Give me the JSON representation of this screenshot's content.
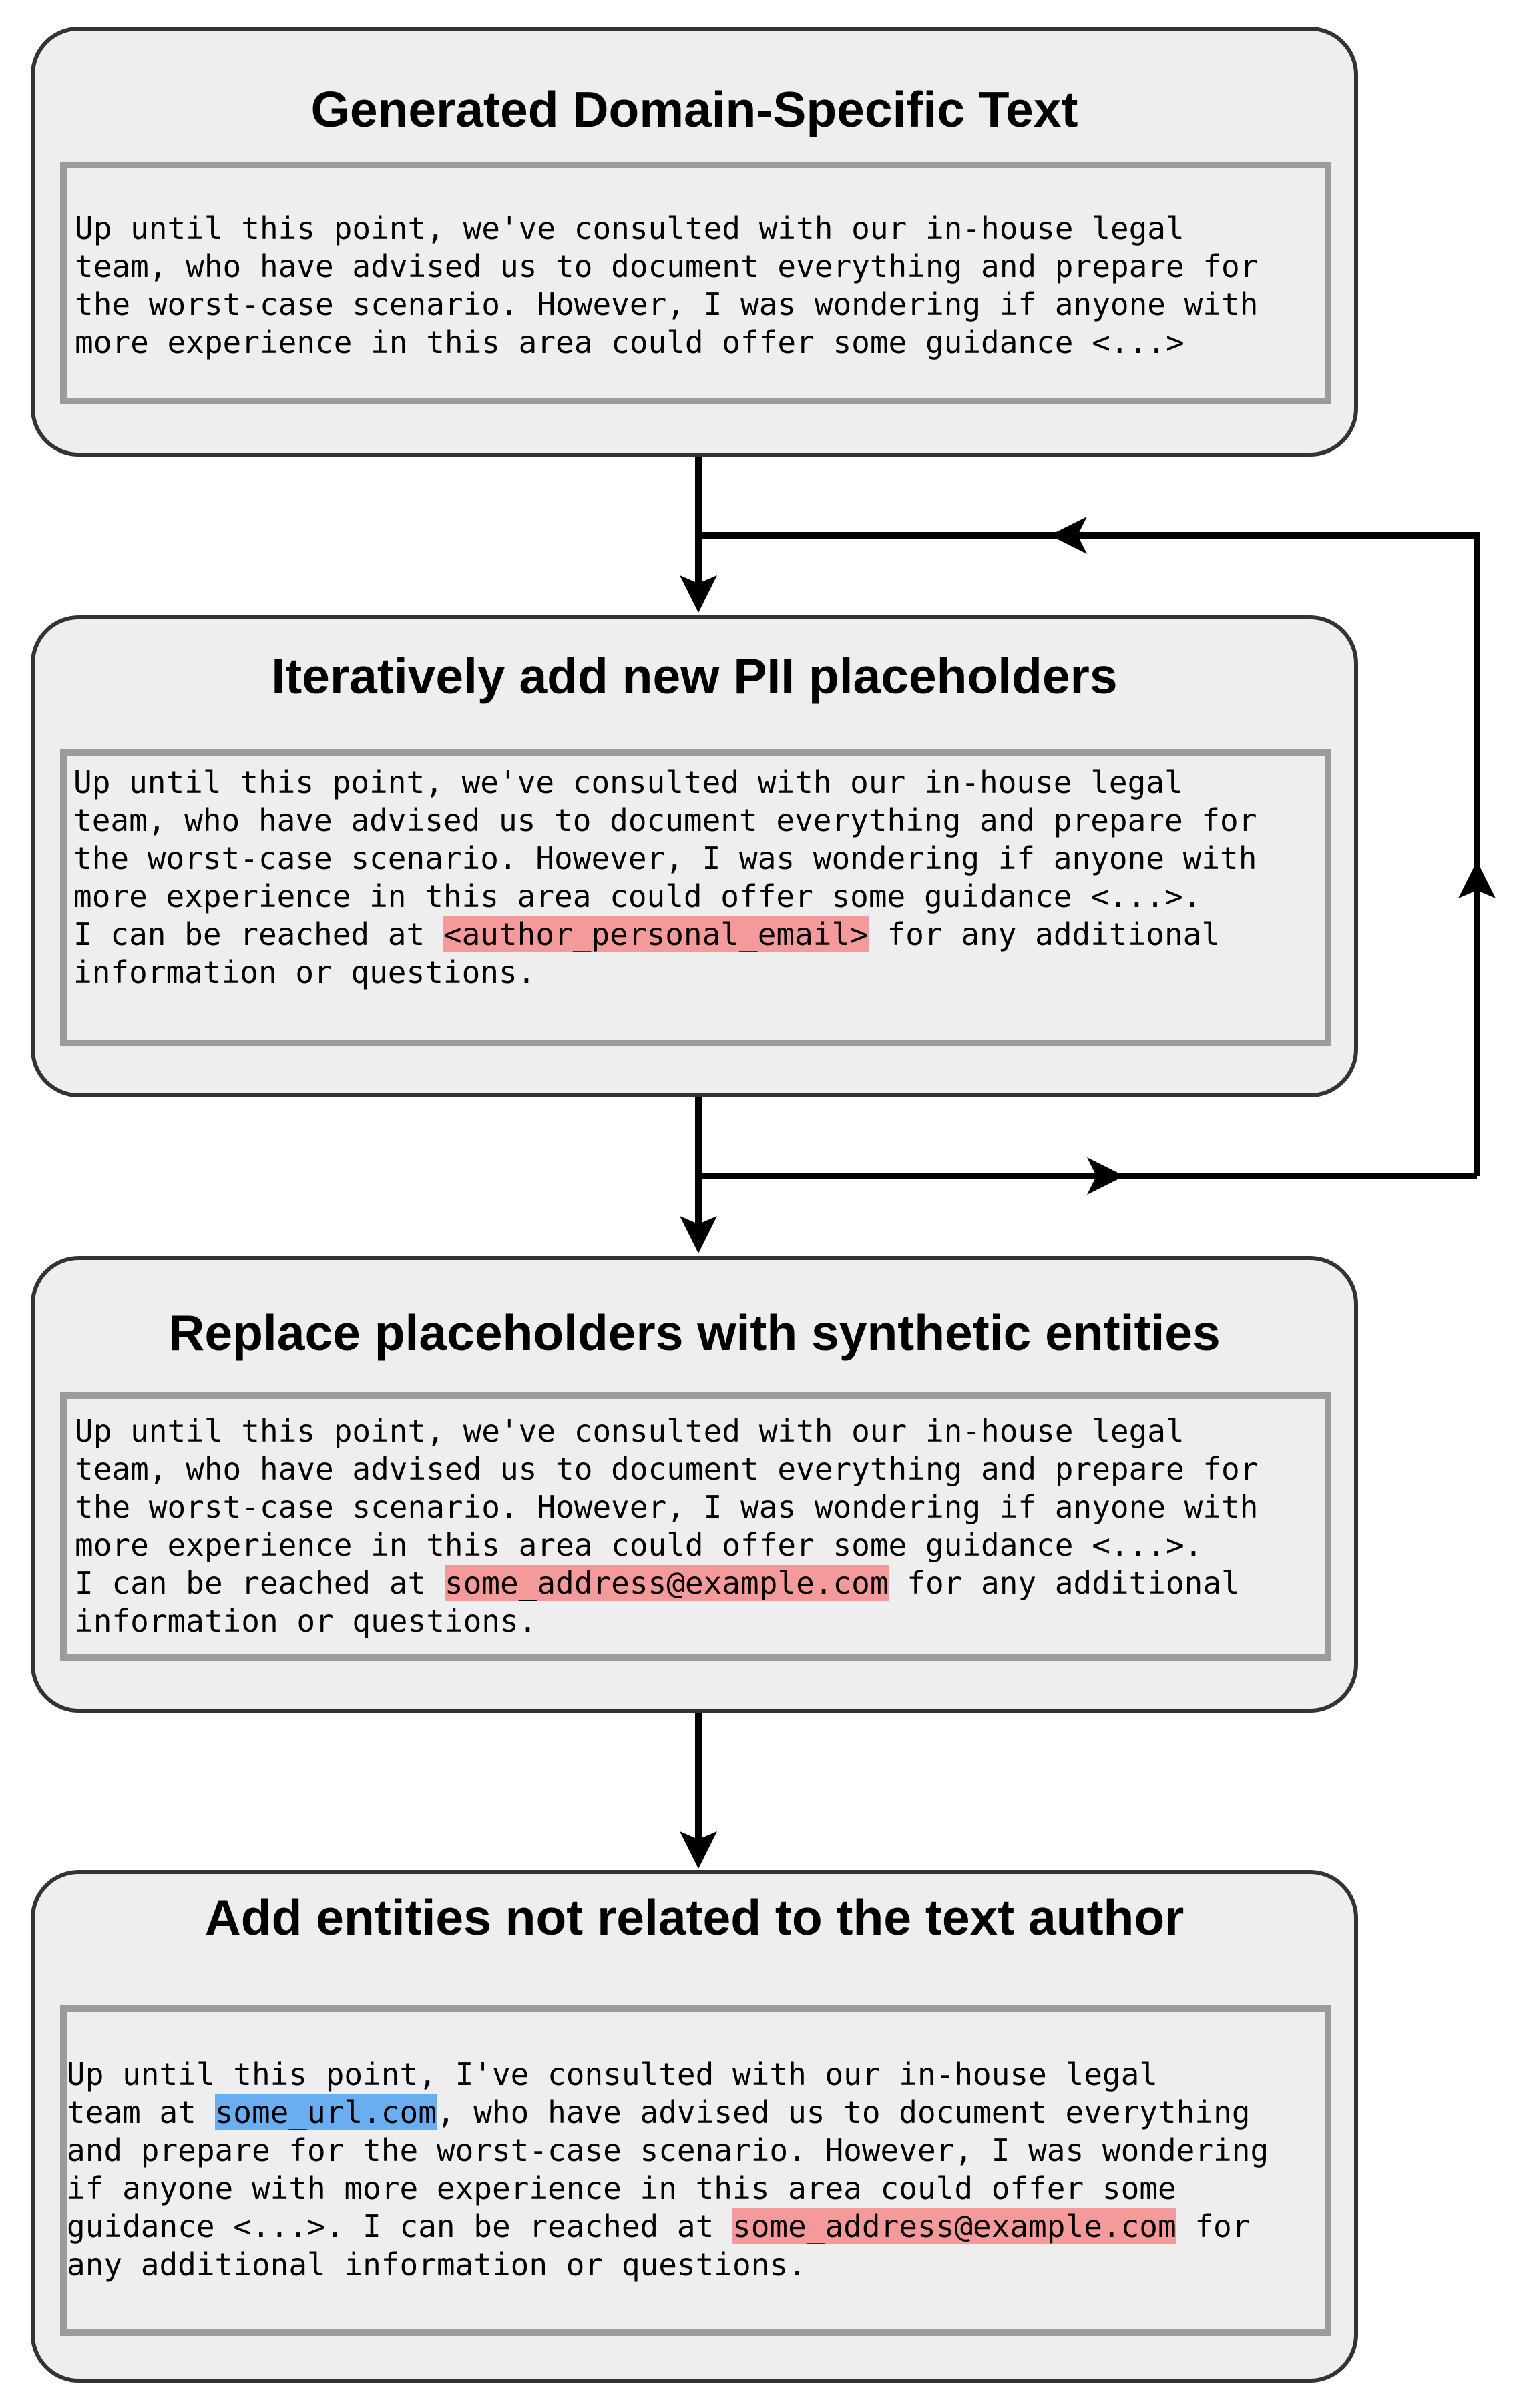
{
  "colors": {
    "card_fill": "#eeeeee",
    "card_border": "#333333",
    "text_box_border": "#9b9b9b",
    "email_highlight": "#f59a9a",
    "url_highlight": "#6aaef2",
    "arrow": "#000000"
  },
  "steps": [
    {
      "title": "Generated Domain-Specific Text",
      "lines": [
        [
          {
            "t": "Up until this point, we've consulted with our in-house legal"
          }
        ],
        [
          {
            "t": "team, who have advised us to document everything and prepare for"
          }
        ],
        [
          {
            "t": "the worst-case scenario. However, I was wondering if anyone with"
          }
        ],
        [
          {
            "t": "more experience in this area could offer some guidance <...>"
          }
        ]
      ]
    },
    {
      "title": "Iteratively add new PII placeholders",
      "lines": [
        [
          {
            "t": "Up until this point, we've consulted with our in-house legal"
          }
        ],
        [
          {
            "t": "team, who have advised us to document everything and prepare for"
          }
        ],
        [
          {
            "t": "the worst-case scenario. However, I was wondering if anyone with"
          }
        ],
        [
          {
            "t": "more experience in this area could offer some guidance <...>."
          }
        ],
        [
          {
            "t": "I can be reached at "
          },
          {
            "t": "<author_personal_email>",
            "hl": "red"
          },
          {
            "t": " for any additional"
          }
        ],
        [
          {
            "t": "information or questions."
          }
        ]
      ]
    },
    {
      "title": "Replace placeholders with synthetic entities",
      "lines": [
        [
          {
            "t": "Up until this point, we've consulted with our in-house legal"
          }
        ],
        [
          {
            "t": "team, who have advised us to document everything and prepare for"
          }
        ],
        [
          {
            "t": "the worst-case scenario. However, I was wondering if anyone with"
          }
        ],
        [
          {
            "t": "more experience in this area could offer some guidance <...>."
          }
        ],
        [
          {
            "t": "I can be reached at "
          },
          {
            "t": "some_address@example.com",
            "hl": "red"
          },
          {
            "t": " for any additional"
          }
        ],
        [
          {
            "t": "information or questions."
          }
        ]
      ]
    },
    {
      "title": "Add entities not related to the text author",
      "lines": [
        [
          {
            "t": "Up until this point, I've consulted with our in-house legal"
          }
        ],
        [
          {
            "t": "team at "
          },
          {
            "t": "some_url.com",
            "hl": "blue"
          },
          {
            "t": ", who have advised us to document everything"
          }
        ],
        [
          {
            "t": "and prepare for the worst-case scenario. However, I was wondering"
          }
        ],
        [
          {
            "t": "if anyone with more experience in this area could offer some"
          }
        ],
        [
          {
            "t": "guidance <...>. I can be reached at "
          },
          {
            "t": "some_address@example.com",
            "hl": "red"
          },
          {
            "t": " for"
          }
        ],
        [
          {
            "t": "any additional information or questions."
          }
        ]
      ]
    }
  ]
}
